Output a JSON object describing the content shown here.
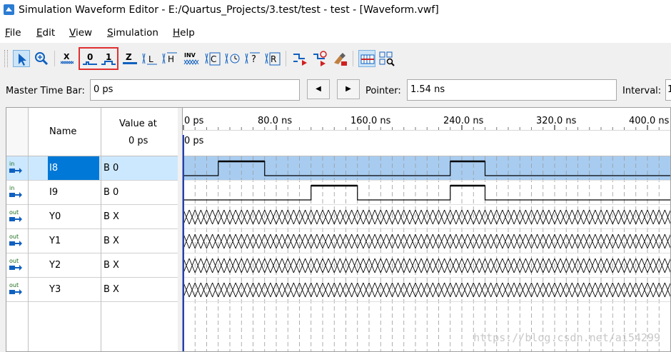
{
  "window": {
    "title": "Simulation Waveform Editor - E:/Quartus_Projects/3.test/test - test - [Waveform.vwf]"
  },
  "menu": [
    {
      "label": "File",
      "mnemonic": "F",
      "rest": "ile"
    },
    {
      "label": "Edit",
      "mnemonic": "E",
      "rest": "dit"
    },
    {
      "label": "View",
      "mnemonic": "V",
      "rest": "iew"
    },
    {
      "label": "Simulation",
      "mnemonic": "S",
      "rest": "imulation"
    },
    {
      "label": "Help",
      "mnemonic": "H",
      "rest": "elp"
    }
  ],
  "toolbar": {
    "icons": [
      {
        "name": "select-pointer-icon",
        "text": ""
      },
      {
        "name": "zoom-icon",
        "text": ""
      },
      {
        "name": "force-unknown-icon",
        "text": "X"
      },
      {
        "name": "force-low-icon",
        "text": "0"
      },
      {
        "name": "force-high-icon",
        "text": "1"
      },
      {
        "name": "high-impedance-icon",
        "text": "Z"
      },
      {
        "name": "weak-low-icon",
        "text": "L"
      },
      {
        "name": "weak-high-icon",
        "text": "H"
      },
      {
        "name": "invert-icon",
        "text": "INV"
      },
      {
        "name": "count-value-icon",
        "text": "C"
      },
      {
        "name": "clock-icon",
        "text": ""
      },
      {
        "name": "arbitrary-value-icon",
        "text": "?"
      },
      {
        "name": "random-value-icon",
        "text": "R"
      },
      {
        "name": "functional-simulation-icon",
        "text": ""
      },
      {
        "name": "timing-simulation-icon",
        "text": ""
      },
      {
        "name": "netlist-simulation-icon",
        "text": ""
      },
      {
        "name": "snap-to-grid-icon",
        "text": ""
      },
      {
        "name": "node-finder-icon",
        "text": ""
      }
    ]
  },
  "timebar": {
    "master_label": "Master Time Bar:",
    "master_value": "0 ps",
    "pointer_label": "Pointer:",
    "pointer_value": "1.54 ns",
    "interval_label": "Interval:",
    "interval_value": "1"
  },
  "grid": {
    "name_header": "Name",
    "value_header_line1": "Value at",
    "value_header_line2": "0 ps",
    "time_ticks": [
      "0 ps",
      "80.0 ns",
      "160.0 ns",
      "240.0 ns",
      "320.0 ns",
      "400.0 ns"
    ],
    "cursor_label": "0 ps",
    "ns_per_tick": 80,
    "time_range_ns": [
      0,
      420
    ],
    "signals": [
      {
        "dir": "in",
        "name": "I8",
        "value": "B 0",
        "selected": true,
        "pulses_ns": [
          [
            30,
            70
          ],
          [
            230,
            260
          ]
        ],
        "unknown": false
      },
      {
        "dir": "in",
        "name": "I9",
        "value": "B 0",
        "selected": false,
        "pulses_ns": [
          [
            110,
            150
          ],
          [
            230,
            260
          ]
        ],
        "unknown": false
      },
      {
        "dir": "out",
        "name": "Y0",
        "value": "B X",
        "selected": false,
        "pulses_ns": [],
        "unknown": true
      },
      {
        "dir": "out",
        "name": "Y1",
        "value": "B X",
        "selected": false,
        "pulses_ns": [],
        "unknown": true
      },
      {
        "dir": "out",
        "name": "Y2",
        "value": "B X",
        "selected": false,
        "pulses_ns": [],
        "unknown": true
      },
      {
        "dir": "out",
        "name": "Y3",
        "value": "B X",
        "selected": false,
        "pulses_ns": [],
        "unknown": true
      }
    ]
  },
  "watermark": "https://blog.csdn.net/ai54299",
  "colors": {
    "selection": "#0078d7",
    "selected_row": "#cce8ff",
    "wave_selected_bg": "#a8ccf0",
    "cursor": "#2040c0",
    "highlight_box": "#e03030"
  }
}
